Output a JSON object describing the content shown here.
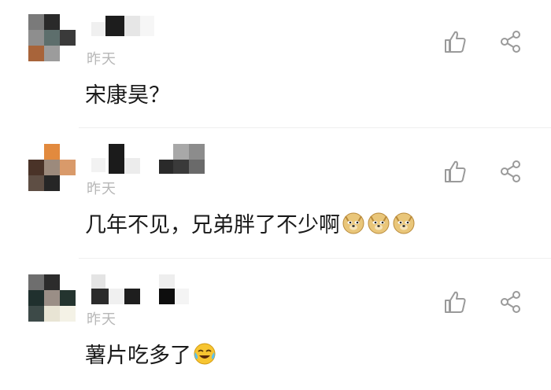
{
  "comments": [
    {
      "time": "昨天",
      "text": "宋康昊？",
      "emojis": []
    },
    {
      "time": "昨天",
      "text": "几年不见，兄弟胖了不少啊",
      "emojis": [
        "doge-emoji",
        "doge-emoji",
        "doge-emoji"
      ]
    },
    {
      "time": "昨天",
      "text": "薯片吃多了",
      "emojis": [
        "laugh-cry-emoji"
      ]
    }
  ],
  "colors": {
    "time": "#b7b7b7",
    "text": "#1a1a1a",
    "icon": "#9a9a9a",
    "divider": "#efefef"
  }
}
